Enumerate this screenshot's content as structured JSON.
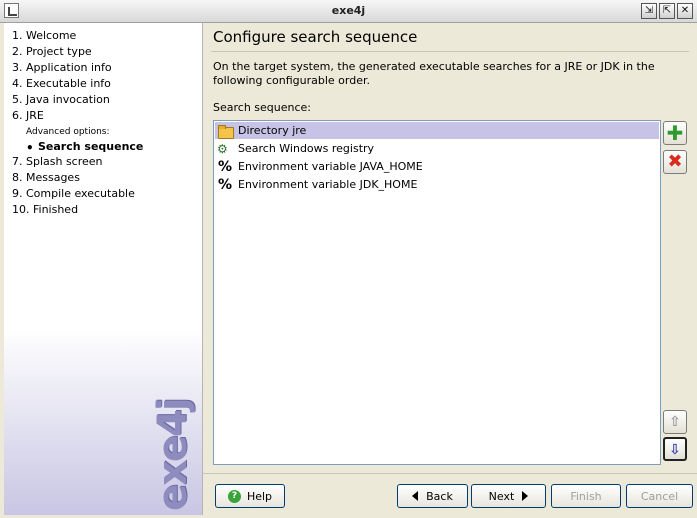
{
  "window": {
    "title": "exe4j",
    "minimize_glyph": "⇲",
    "maximize_glyph": "⇱",
    "close_glyph": "✕"
  },
  "steps": [
    "1. Welcome",
    "2. Project type",
    "3. Application info",
    "4. Executable info",
    "5. Java invocation",
    "6. JRE",
    "7. Splash screen",
    "8. Messages",
    "9. Compile executable",
    "10. Finished"
  ],
  "advanced": {
    "label": "Advanced options:",
    "bullet": "•",
    "current": "Search sequence"
  },
  "logo": {
    "text": "exe4j"
  },
  "page": {
    "title": "Configure search sequence",
    "description": "On the target system, the generated executable searches for a JRE or JDK in the following configurable order.",
    "sequence_label": "Search sequence:"
  },
  "sequence": [
    {
      "icon": "folder-icon",
      "label": "Directory jre",
      "selected": true
    },
    {
      "icon": "registry-icon",
      "label": "Search Windows registry",
      "selected": false
    },
    {
      "icon": "percent-icon",
      "label": "Environment variable JAVA_HOME",
      "selected": false
    },
    {
      "icon": "percent-icon",
      "label": "Environment variable JDK_HOME",
      "selected": false
    }
  ],
  "side_buttons": {
    "add": "✚",
    "remove": "✖",
    "up": "⇧",
    "down": "⇩"
  },
  "buttons": {
    "help": "Help",
    "back": "Back",
    "next": "Next",
    "finish": "Finish",
    "cancel": "Cancel"
  },
  "glyphs": {
    "help_icon": "?",
    "registry_icon": "⚙",
    "percent_icon": "%"
  }
}
